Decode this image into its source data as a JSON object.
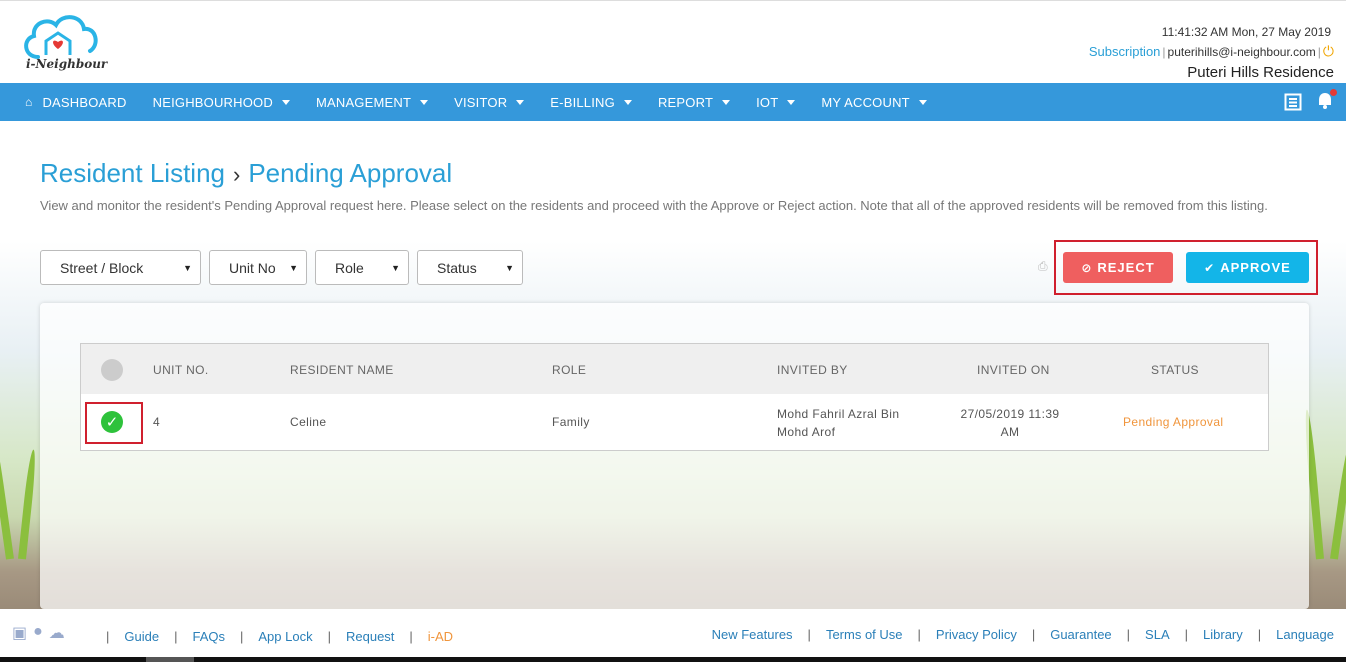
{
  "header": {
    "logo_text": "i-Neighbour",
    "datetime": "11:41:32 AM  Mon, 27 May 2019",
    "subscription": "Subscription",
    "email": "puterihills@i-neighbour.com",
    "residence": "Puteri Hills Residence"
  },
  "nav": {
    "items": [
      {
        "label": "DASHBOARD"
      },
      {
        "label": "NEIGHBOURHOOD"
      },
      {
        "label": "MANAGEMENT"
      },
      {
        "label": "VISITOR"
      },
      {
        "label": "E-BILLING"
      },
      {
        "label": "REPORT"
      },
      {
        "label": "IOT"
      },
      {
        "label": "MY ACCOUNT"
      }
    ]
  },
  "page": {
    "breadcrumb_root": "Resident Listing",
    "breadcrumb_current": "Pending Approval",
    "description": "View and monitor the resident's Pending Approval request here. Please select on the residents and proceed with the Approve or Reject action. Note that all of the approved residents will be removed from this listing."
  },
  "filters": {
    "street_block": "Street / Block",
    "unit_no": "Unit No",
    "role": "Role",
    "status": "Status"
  },
  "actions": {
    "reject": "REJECT",
    "approve": "APPROVE"
  },
  "table": {
    "headers": {
      "unit_no": "UNIT NO.",
      "resident_name": "RESIDENT NAME",
      "role": "ROLE",
      "invited_by": "INVITED BY",
      "invited_on": "INVITED ON",
      "status": "STATUS"
    },
    "rows": [
      {
        "unit_no": "4",
        "resident_name": "Celine",
        "role": "Family",
        "invited_by_1": "Mohd Fahril Azral Bin",
        "invited_by_2": "Mohd Arof",
        "invited_on_1": "27/05/2019 11:39",
        "invited_on_2": "AM",
        "status": "Pending Approval"
      }
    ]
  },
  "footer": {
    "left": [
      "Guide",
      "FAQs",
      "App Lock",
      "Request",
      "i-AD"
    ],
    "right": [
      "New Features",
      "Terms of Use",
      "Privacy Policy",
      "Guarantee",
      "SLA",
      "Library",
      "Language"
    ]
  },
  "colors": {
    "nav_bg": "#3598db",
    "accent": "#2a9fd6",
    "reject": "#ef5f5f",
    "approve": "#13b5e8",
    "pending": "#f0953c",
    "highlight": "#d0202e"
  }
}
